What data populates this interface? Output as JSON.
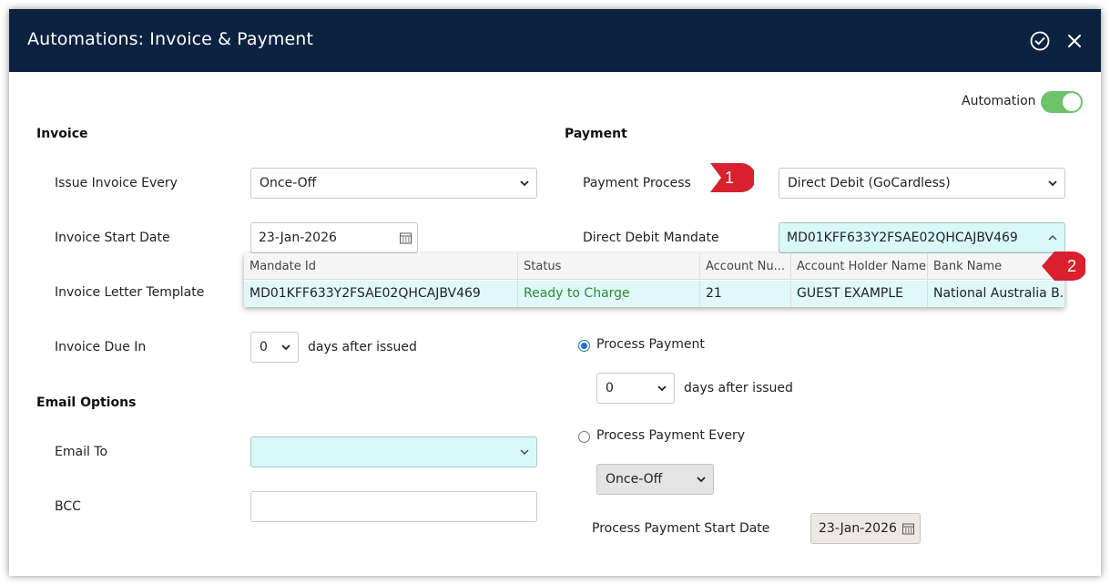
{
  "header": {
    "title": "Automations: Invoice & Payment"
  },
  "automation": {
    "label": "Automation",
    "enabled": true
  },
  "invoice": {
    "section_title": "Invoice",
    "issue_every": {
      "label": "Issue Invoice Every",
      "value": "Once-Off"
    },
    "start_date": {
      "label": "Invoice Start Date",
      "value": "23-Jan-2026"
    },
    "letter_template": {
      "label": "Invoice Letter Template"
    },
    "due_in": {
      "label": "Invoice Due In",
      "value": "0",
      "suffix": "days after issued"
    }
  },
  "email": {
    "section_title": "Email Options",
    "to": {
      "label": "Email To",
      "value": ""
    },
    "bcc": {
      "label": "BCC",
      "value": ""
    }
  },
  "payment": {
    "section_title": "Payment",
    "process": {
      "label": "Payment Process",
      "value": "Direct Debit (GoCardless)"
    },
    "mandate": {
      "label": "Direct Debit Mandate",
      "value": "MD01KFF633Y2FSAE02QHCAJBV469"
    },
    "process_payment": {
      "label": "Process Payment",
      "selected": true,
      "days": "0",
      "suffix": "days after issued"
    },
    "process_every": {
      "label": "Process Payment Every",
      "selected": false,
      "value": "Once-Off"
    },
    "start_date": {
      "label": "Process Payment Start Date",
      "value": "23-Jan-2026"
    }
  },
  "mandate_table": {
    "headers": [
      "Mandate Id",
      "Status",
      "Account Nu...",
      "Account Holder Name",
      "Bank Name"
    ],
    "row": [
      "MD01KFF633Y2FSAE02QHCAJBV469",
      "Ready to Charge",
      "21",
      "GUEST EXAMPLE",
      "National Australia B..."
    ]
  },
  "markers": [
    "1",
    "2"
  ],
  "colors": {
    "header_bg": "#0b2240",
    "toggle_on": "#6cc36c",
    "marker_red": "#d8202f",
    "ready_text": "#2c8a2c",
    "highlight": "#e0f8fa"
  }
}
